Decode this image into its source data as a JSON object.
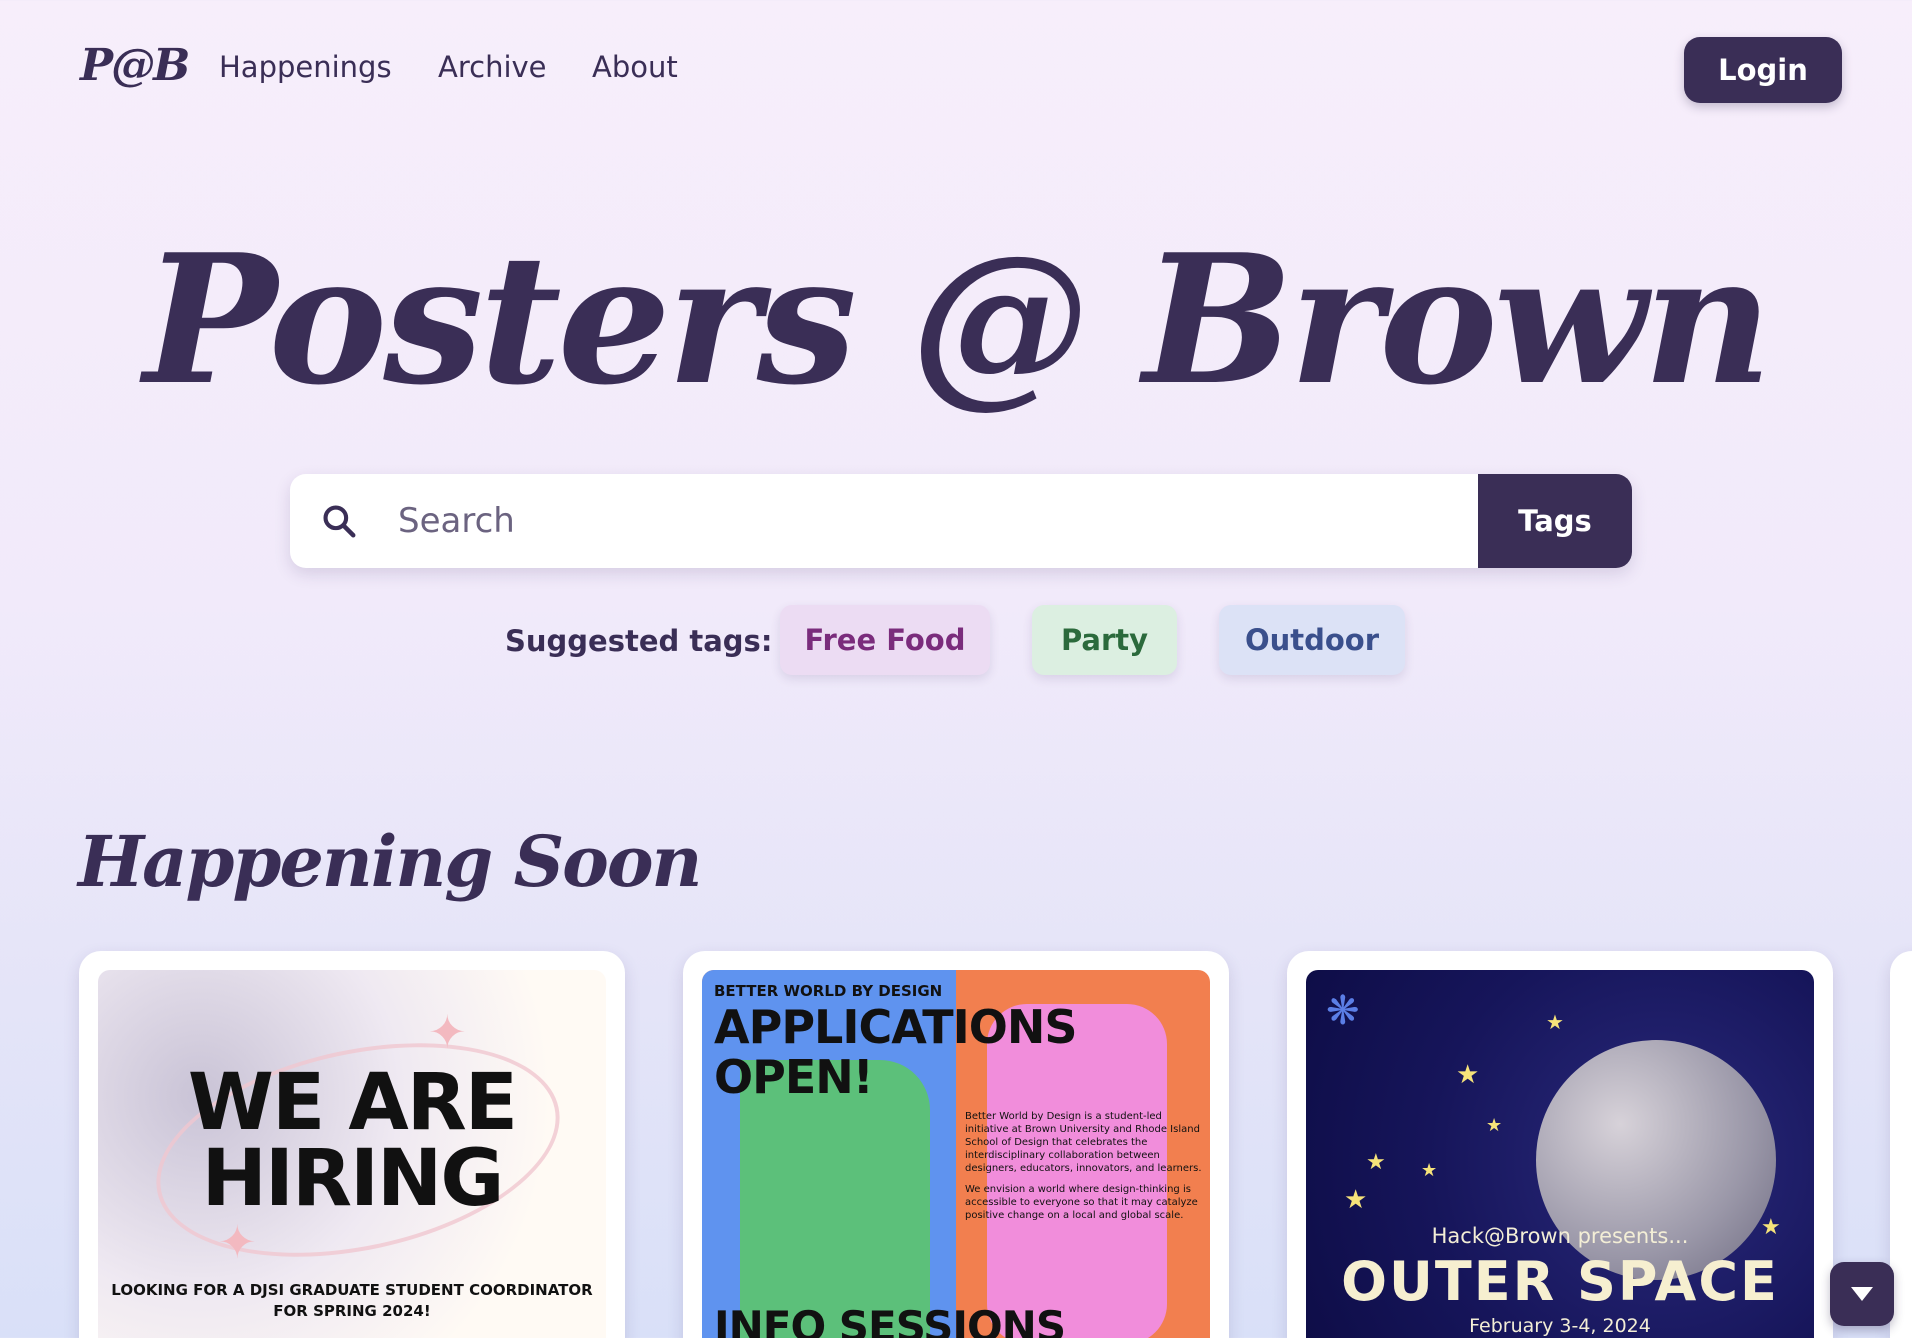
{
  "nav": {
    "logo": "P@B",
    "links": [
      "Happenings",
      "Archive",
      "About"
    ],
    "login_label": "Login"
  },
  "hero": {
    "title": "Posters @ Brown"
  },
  "search": {
    "placeholder": "Search",
    "value": "",
    "tags_label": "Tags"
  },
  "suggested": {
    "label": "Suggested tags:",
    "tags": [
      "Free Food",
      "Party",
      "Outdoor"
    ]
  },
  "section": {
    "title": "Happening Soon"
  },
  "cards": [
    {
      "headline": "WE ARE HIRING",
      "subtext": "LOOKING FOR A DJSI GRADUATE STUDENT COORDINATOR FOR SPRING 2024!"
    },
    {
      "kicker": "BETTER WORLD BY DESIGN",
      "headline": "APPLICATIONS OPEN!",
      "body1": "Better World by Design is a student-led initiative at Brown University and Rhode Island School of Design that celebrates the interdisciplinary collaboration between designers, educators, innovators, and learners.",
      "body2": "We envision a world where design-thinking is accessible to everyone so that it may catalyze positive change on a local and global scale.",
      "bottom": "INFO SESSIONS"
    },
    {
      "presents": "Hack@Brown presents...",
      "headline": "OUTER SPACE",
      "date": "February 3-4, 2024"
    }
  ],
  "colors": {
    "primary": "#3a2e56",
    "chip_food_bg": "#ecdcf3",
    "chip_party_bg": "#dcefe1",
    "chip_outdoor_bg": "#dce2f6"
  },
  "icons": {
    "search": "search-icon",
    "scroll": "chevron-down-icon"
  }
}
